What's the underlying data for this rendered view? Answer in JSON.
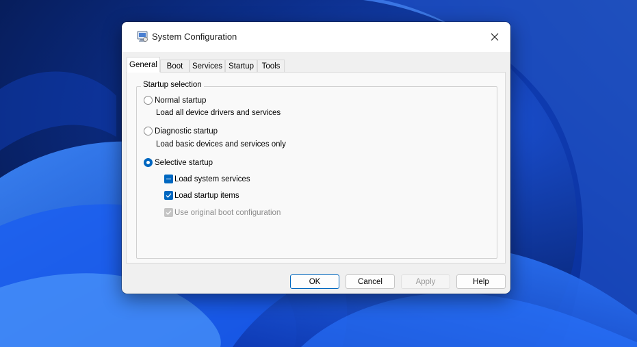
{
  "window": {
    "title": "System Configuration",
    "app_icon": "msconfig-icon",
    "close_icon": "close-icon"
  },
  "tabs": [
    {
      "label": "General",
      "active": true
    },
    {
      "label": "Boot",
      "active": false
    },
    {
      "label": "Services",
      "active": false
    },
    {
      "label": "Startup",
      "active": false
    },
    {
      "label": "Tools",
      "active": false
    }
  ],
  "startup_selection": {
    "group_label": "Startup selection",
    "normal": {
      "label": "Normal startup",
      "description": "Load all device drivers and services",
      "checked": false
    },
    "diagnostic": {
      "label": "Diagnostic startup",
      "description": "Load basic devices and services only",
      "checked": false
    },
    "selective": {
      "label": "Selective startup",
      "checked": true,
      "options": {
        "system_services": {
          "label": "Load system services",
          "state": "indeterminate"
        },
        "startup_items": {
          "label": "Load startup items",
          "state": "checked"
        },
        "original_boot": {
          "label": "Use original boot configuration",
          "state": "checked",
          "disabled": true
        }
      }
    }
  },
  "buttons": {
    "ok": "OK",
    "cancel": "Cancel",
    "apply": "Apply",
    "help": "Help"
  },
  "colors": {
    "accent": "#0067c0",
    "wallpaper_base": "#0b2a78",
    "wallpaper_bloom": "#1d6cff"
  }
}
